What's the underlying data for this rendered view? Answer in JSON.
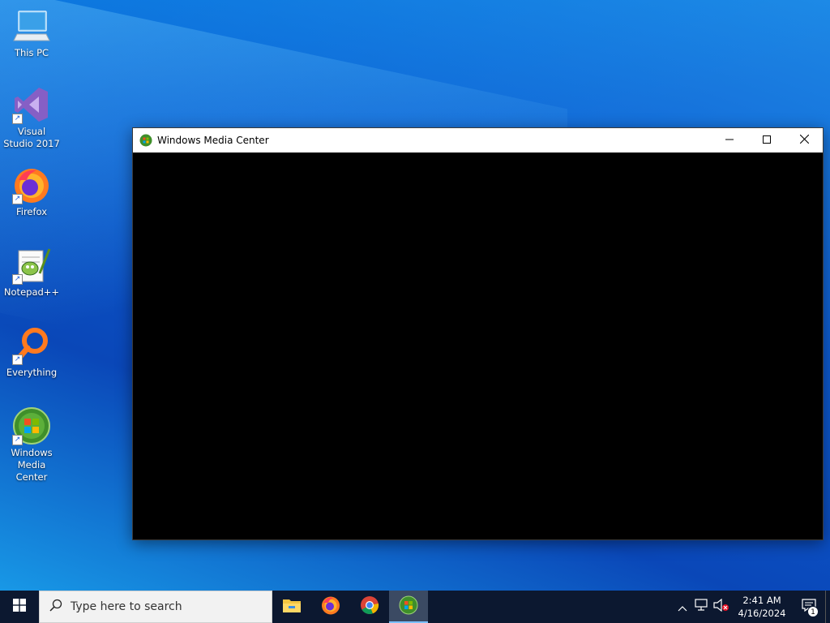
{
  "desktop": {
    "icons": [
      {
        "label": "This PC",
        "icon": "computer-icon"
      },
      {
        "label": "Visual Studio 2017",
        "icon": "visual-studio-icon"
      },
      {
        "label": "Firefox",
        "icon": "firefox-icon"
      },
      {
        "label": "Notepad++",
        "icon": "notepadpp-icon"
      },
      {
        "label": "Everything",
        "icon": "everything-icon"
      },
      {
        "label": "Windows Media Center",
        "icon": "media-center-icon"
      }
    ]
  },
  "window": {
    "title": "Windows Media Center",
    "icon": "media-center-icon",
    "minimize_icon": "minimize-icon",
    "maximize_icon": "maximize-icon",
    "close_icon": "close-icon"
  },
  "taskbar": {
    "start_icon": "windows-logo-icon",
    "search_placeholder": "Type here to search",
    "apps": [
      {
        "name": "File Explorer",
        "icon": "folder-icon",
        "state": "normal"
      },
      {
        "name": "Firefox",
        "icon": "firefox-icon",
        "state": "normal"
      },
      {
        "name": "Chrome",
        "icon": "chrome-icon",
        "state": "normal"
      },
      {
        "name": "Windows Media Center",
        "icon": "media-center-icon",
        "state": "active"
      }
    ],
    "tray": {
      "time": "2:41 AM",
      "date": "4/16/2024",
      "notification_count": "1"
    }
  },
  "colors": {
    "taskbar_bg": "#0c1830",
    "accent": "#7cc0ff",
    "window_client": "#000000"
  }
}
